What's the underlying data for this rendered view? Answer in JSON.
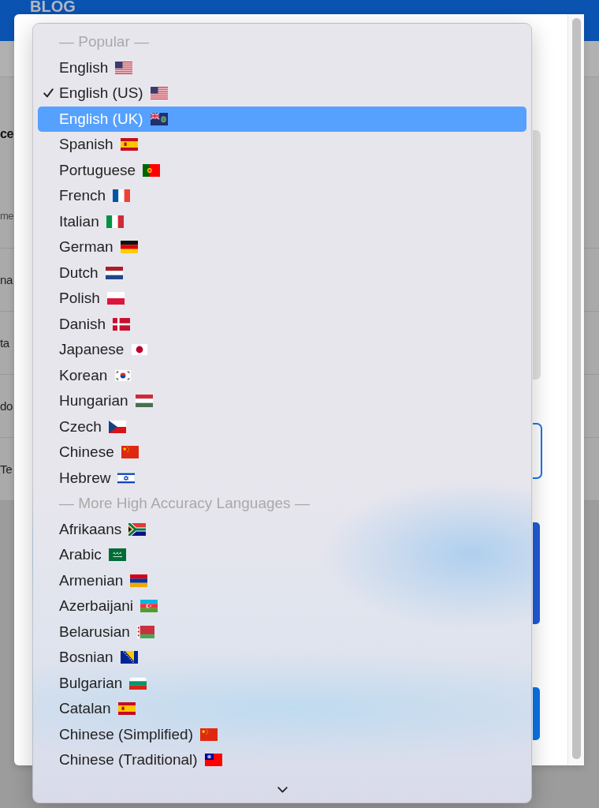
{
  "background_page": {
    "header": {
      "title": "BLOG"
    },
    "heading": "ce",
    "column_1_header": "me",
    "rows": [
      {
        "column_1": "na"
      },
      {
        "column_1": "ta"
      },
      {
        "column_1": "do"
      },
      {
        "column_1": "Te"
      }
    ]
  },
  "dropdown": {
    "sections": [
      {
        "heading": "— Popular —",
        "items": [
          {
            "label": "English",
            "kind": "us",
            "checked": false,
            "selected": false
          },
          {
            "label": "English (US)",
            "kind": "us",
            "checked": true,
            "selected": false
          },
          {
            "label": "English (UK)",
            "kind": "ensign",
            "checked": false,
            "selected": true
          },
          {
            "label": "Spanish",
            "kind": "es",
            "checked": false,
            "selected": false
          },
          {
            "label": "Portuguese",
            "kind": "pt",
            "checked": false,
            "selected": false
          },
          {
            "label": "French",
            "kind": "fr",
            "checked": false,
            "selected": false
          },
          {
            "label": "Italian",
            "kind": "it",
            "checked": false,
            "selected": false
          },
          {
            "label": "German",
            "kind": "de",
            "checked": false,
            "selected": false
          },
          {
            "label": "Dutch",
            "kind": "nl",
            "checked": false,
            "selected": false
          },
          {
            "label": "Polish",
            "kind": "pl",
            "checked": false,
            "selected": false
          },
          {
            "label": "Danish",
            "kind": "dk",
            "checked": false,
            "selected": false
          },
          {
            "label": "Japanese",
            "kind": "jp",
            "checked": false,
            "selected": false
          },
          {
            "label": "Korean",
            "kind": "kr",
            "checked": false,
            "selected": false
          },
          {
            "label": "Hungarian",
            "kind": "hu",
            "checked": false,
            "selected": false
          },
          {
            "label": "Czech",
            "kind": "cz",
            "checked": false,
            "selected": false
          },
          {
            "label": "Chinese",
            "kind": "cn",
            "checked": false,
            "selected": false
          },
          {
            "label": "Hebrew",
            "kind": "il",
            "checked": false,
            "selected": false
          }
        ]
      },
      {
        "heading": "— More High Accuracy Languages —",
        "items": [
          {
            "label": "Afrikaans",
            "kind": "za",
            "checked": false,
            "selected": false
          },
          {
            "label": "Arabic",
            "kind": "sa",
            "checked": false,
            "selected": false
          },
          {
            "label": "Armenian",
            "kind": "am",
            "checked": false,
            "selected": false
          },
          {
            "label": "Azerbaijani",
            "kind": "az",
            "checked": false,
            "selected": false
          },
          {
            "label": "Belarusian",
            "kind": "by",
            "checked": false,
            "selected": false
          },
          {
            "label": "Bosnian",
            "kind": "ba",
            "checked": false,
            "selected": false
          },
          {
            "label": "Bulgarian",
            "kind": "bg",
            "checked": false,
            "selected": false
          },
          {
            "label": "Catalan",
            "kind": "es",
            "checked": false,
            "selected": false
          },
          {
            "label": "Chinese (Simplified)",
            "kind": "cn",
            "checked": false,
            "selected": false
          },
          {
            "label": "Chinese (Traditional)",
            "kind": "tw",
            "checked": false,
            "selected": false
          }
        ]
      }
    ]
  }
}
